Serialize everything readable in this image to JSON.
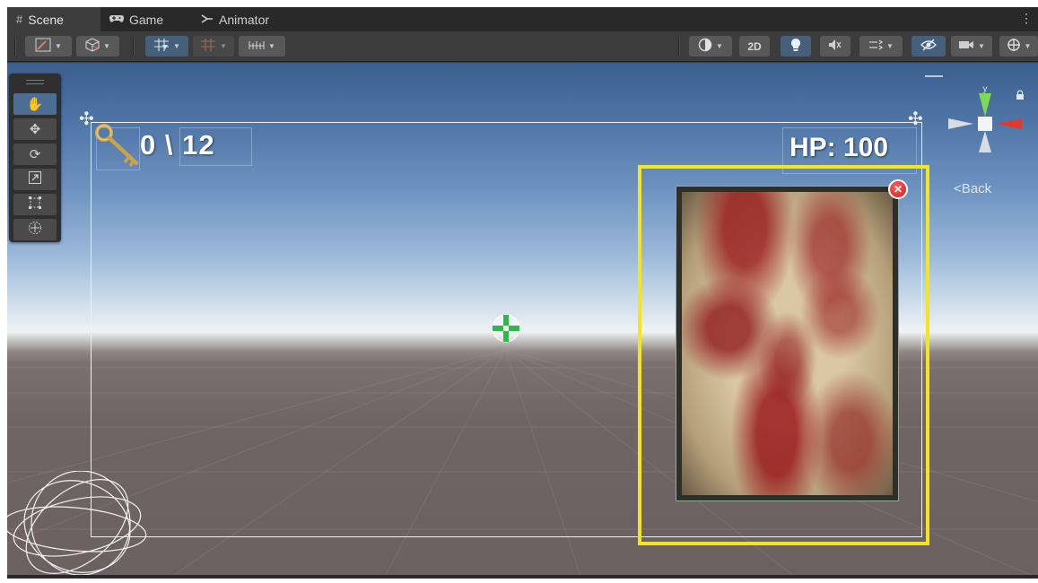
{
  "tabs": [
    {
      "label": "Scene",
      "icon": "hash-icon",
      "active": true
    },
    {
      "label": "Game",
      "icon": "gamepad-icon",
      "active": false
    },
    {
      "label": "Animator",
      "icon": "animator-icon",
      "active": false
    }
  ],
  "toolbar": {
    "draw_mode_icon": "brush-icon",
    "render_mode_icon": "cube-icon",
    "grid_snap_icon": "grid-snap-icon",
    "grid_icon": "grid-icon",
    "ruler_icon": "ruler-icon",
    "shading_icon": "shading-sphere-icon",
    "mode_2d_label": "2D",
    "lighting_icon": "lightbulb-icon",
    "audio_icon": "audio-icon",
    "effects_icon": "effects-icon",
    "visibility_icon": "hidden-eye-icon",
    "camera_icon": "camera-icon",
    "gizmos_icon": "gizmo-icon"
  },
  "tools": [
    {
      "name": "hand-tool",
      "icon": "hand-icon",
      "active": true
    },
    {
      "name": "move-tool",
      "icon": "move-arrows-icon",
      "active": false
    },
    {
      "name": "rotate-tool",
      "icon": "rotate-icon",
      "active": false
    },
    {
      "name": "scale-tool",
      "icon": "scale-icon",
      "active": false
    },
    {
      "name": "rect-tool",
      "icon": "rect-icon",
      "active": false
    },
    {
      "name": "transform-tool",
      "icon": "transform-icon",
      "active": false
    }
  ],
  "hud": {
    "key_count": "0 \\ 12",
    "hp": "HP: 100"
  },
  "gizmo": {
    "axis_y": "y",
    "back_label": "Back"
  },
  "colors": {
    "selection_outline": "#f5e51e",
    "canvas_outline": "#f0f0f0",
    "active_tool": "#4d6e94",
    "close_badge": "#d41a1a",
    "gizmo_y": "#7ed957",
    "gizmo_x": "#e03a2f"
  }
}
